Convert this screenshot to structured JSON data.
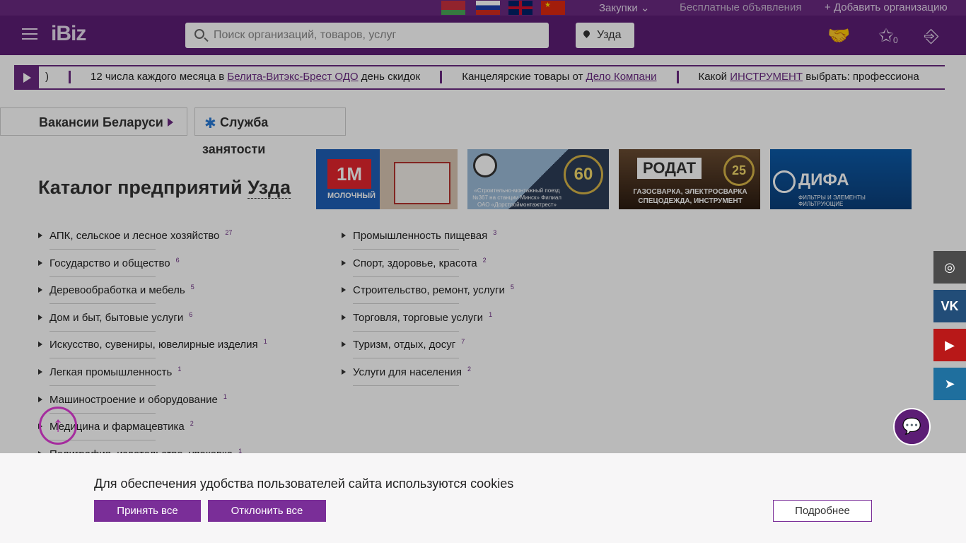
{
  "colors": {
    "brand": "#5c1d75",
    "accent": "#7a2e98",
    "link": "#6a2a82"
  },
  "topbar": {
    "languages": [
      "by",
      "ru",
      "en",
      "cn"
    ],
    "zakupki": "Закупки",
    "free_ads": "Бесплатные объявления",
    "add_org": "Добавить организацию"
  },
  "header": {
    "logo": "iBiz",
    "search_placeholder": "Поиск организаций, товаров, услуг",
    "city": "Узда",
    "favorites_count": "0"
  },
  "ticker": {
    "items": [
      {
        "pre": ")",
        "link": "",
        "post": ""
      },
      {
        "pre": "12 числа каждого месяца в ",
        "link": "Белита-Витэкс-Брест ОДО",
        "post": " день скидок"
      },
      {
        "pre": "Канцелярские товары от ",
        "link": "Дело Компани",
        "post": ""
      },
      {
        "pre": "Какой ",
        "link": "ИНСТРУМЕНТ",
        "post": " выбрать: профессиона"
      }
    ]
  },
  "buttons": {
    "vacancies": "Вакансии Беларуси",
    "employment_1": "Служба",
    "employment_2": "занятости"
  },
  "catalog": {
    "title": "Каталог предприятий",
    "city": "Узда"
  },
  "banners": {
    "molochny": {
      "logo": "1M",
      "text": "МОЛОЧНЫЙ"
    },
    "poezd": {
      "badge": "60",
      "text": "«Строительно-монтажный поезд №367 на станции Минск» Филиал ОАО «Дорстроймонтажтрест»"
    },
    "rodat": {
      "logo": "РОДАТ",
      "badge": "25",
      "text": "ГАЗОСВАРКА, ЭЛЕКТРОСВАРКА СПЕЦОДЕЖДА, ИНСТРУМЕНТ"
    },
    "difa": {
      "name": "ДИФА",
      "text": "ФИЛЬТРЫ И ЭЛЕМЕНТЫ ФИЛЬТРУЮЩИЕ"
    }
  },
  "categories_left": [
    {
      "name": "АПК, сельское и лесное хозяйство",
      "count": "27"
    },
    {
      "name": "Государство и общество",
      "count": "6"
    },
    {
      "name": "Деревообработка и мебель",
      "count": "5"
    },
    {
      "name": "Дом и быт, бытовые услуги",
      "count": "6"
    },
    {
      "name": "Искусство, сувениры, ювелирные изделия",
      "count": "1"
    },
    {
      "name": "Легкая промышленность",
      "count": "1"
    },
    {
      "name": "Машиностроение и оборудование",
      "count": "1"
    },
    {
      "name": "Медицина и фармацевтика",
      "count": "2"
    },
    {
      "name": "Полиграфия, издательство, упаковка",
      "count": "1"
    }
  ],
  "categories_right": [
    {
      "name": "Промышленность пищевая",
      "count": "3"
    },
    {
      "name": "Спорт, здоровье, красота",
      "count": "2"
    },
    {
      "name": "Строительство, ремонт, услуги",
      "count": "5"
    },
    {
      "name": "Торговля, торговые услуги",
      "count": "1"
    },
    {
      "name": "Туризм, отдых, досуг",
      "count": "7"
    },
    {
      "name": "Услуги для населения",
      "count": "2"
    }
  ],
  "social": [
    "instagram-icon",
    "vk-icon",
    "youtube-icon",
    "telegram-icon"
  ],
  "cookie": {
    "text": "Для обеспечения удобства пользователей сайта используются cookies",
    "accept": "Принять все",
    "decline": "Отклонить все",
    "more": "Подробнее"
  }
}
